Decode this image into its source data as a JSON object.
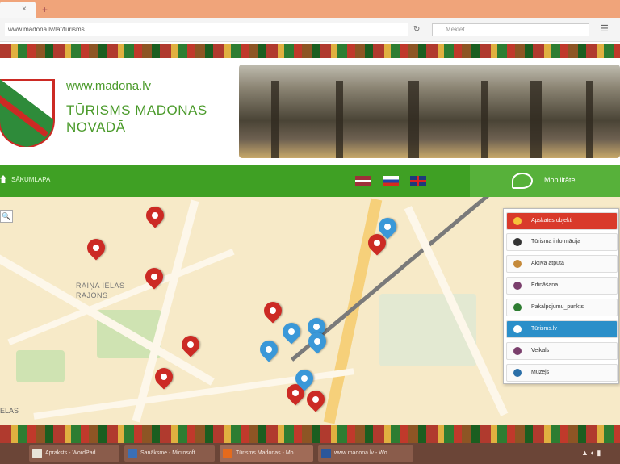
{
  "browser": {
    "tab_close_glyph": "×",
    "new_tab_glyph": "+",
    "url": "www.madona.lv/lat/turisms",
    "search_placeholder": "Meklēt",
    "icons": [
      "reload-icon",
      "search-icon",
      "menu-icon"
    ]
  },
  "header": {
    "site_url": "www.madona.lv",
    "title_line1": "TŪRISMS MADONAS",
    "title_line2": "NOVADĀ"
  },
  "nav": {
    "home_label": "SĀKUMLAPA",
    "mobile_label": "Mobilitāte",
    "languages": [
      "Latviešu",
      "Русский",
      "English"
    ]
  },
  "map": {
    "district_line1": "RAIŅA IELAS",
    "district_line2": "RAJONS",
    "street": "ELAS",
    "zoom_glyph": "🔍",
    "pins": {
      "red_count": 9,
      "blue_count": 6
    }
  },
  "legend": {
    "items": [
      {
        "label": "Apskates objekti",
        "icon": "star-icon",
        "color": "#f6c33b",
        "state": "active-red"
      },
      {
        "label": "Tūrisma informācija",
        "icon": "info-icon",
        "color": "#333333",
        "state": ""
      },
      {
        "label": "Aktīvā atpūta",
        "icon": "bike-icon",
        "color": "#c58a3a",
        "state": ""
      },
      {
        "label": "Ēdināšana",
        "icon": "food-icon",
        "color": "#7a3f6c",
        "state": ""
      },
      {
        "label": "Pakalpojumu_punkts",
        "icon": "home-icon",
        "color": "#2e7d32",
        "state": ""
      },
      {
        "label": "Tūrisms.lv",
        "icon": "bed-icon",
        "color": "#ffffff",
        "state": "active-blue"
      },
      {
        "label": "Veikals",
        "icon": "shop-icon",
        "color": "#7a3f6c",
        "state": ""
      },
      {
        "label": "Muzejs",
        "icon": "globe-icon",
        "color": "#2b6fa8",
        "state": ""
      }
    ]
  },
  "taskbar": {
    "tasks": [
      {
        "label": "Apraksts - WordPad",
        "color": "#e8e4d8"
      },
      {
        "label": "Sanāksme - Microsoft",
        "color": "#3a6fb5"
      },
      {
        "label": "Tūrisms Madonas - Mo",
        "color": "#e56a1c"
      },
      {
        "label": "www.madona.lv - Wo",
        "color": "#2b579a"
      }
    ],
    "tray_glyphs": "▲ ◐ ▮"
  }
}
